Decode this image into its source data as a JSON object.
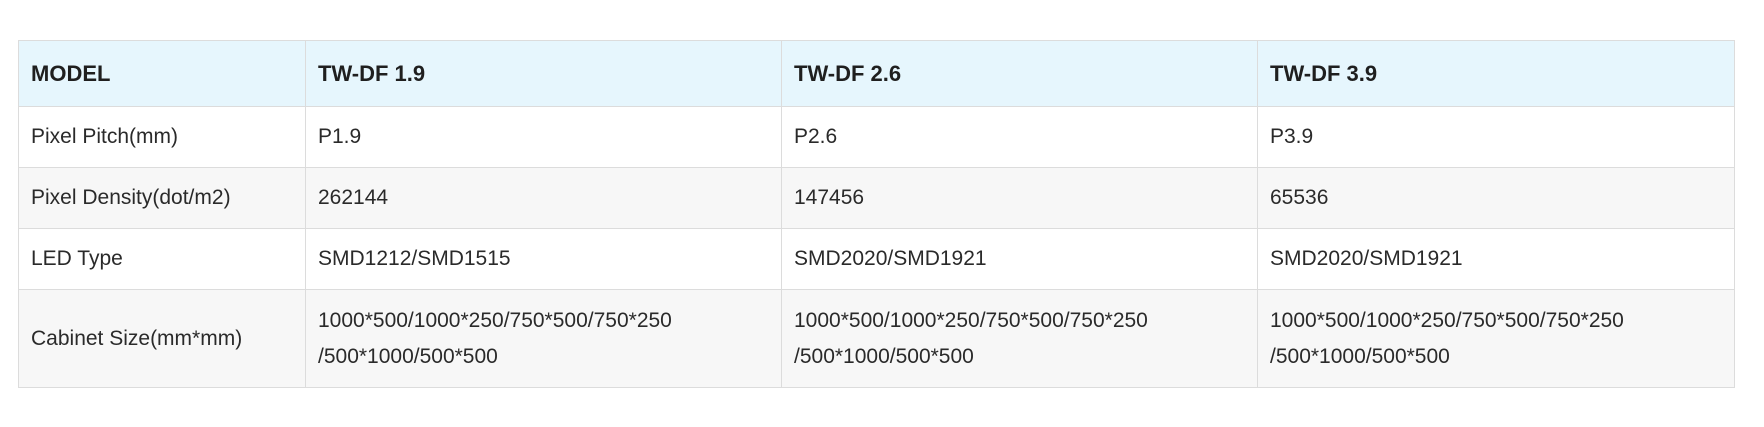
{
  "table": {
    "header": [
      "MODEL",
      "TW-DF 1.9",
      "TW-DF 2.6",
      "TW-DF 3.9"
    ],
    "rows": [
      {
        "label": "Pixel Pitch(mm)",
        "values": [
          "P1.9",
          "P2.6",
          "P3.9"
        ]
      },
      {
        "label": "Pixel Density(dot/m2)",
        "values": [
          "262144",
          "147456",
          "65536"
        ]
      },
      {
        "label": "LED Type",
        "values": [
          "SMD1212/SMD1515",
          "SMD2020/SMD1921",
          "SMD2020/SMD1921"
        ]
      },
      {
        "label": "Cabinet Size(mm*mm)",
        "values": [
          {
            "line1": "1000*500/1000*250/750*500/750*250",
            "line2": "/500*1000/500*500"
          },
          {
            "line1": "1000*500/1000*250/750*500/750*250",
            "line2": "/500*1000/500*500"
          },
          {
            "line1": "1000*500/1000*250/750*500/750*250",
            "line2": "/500*1000/500*500"
          }
        ]
      }
    ]
  }
}
